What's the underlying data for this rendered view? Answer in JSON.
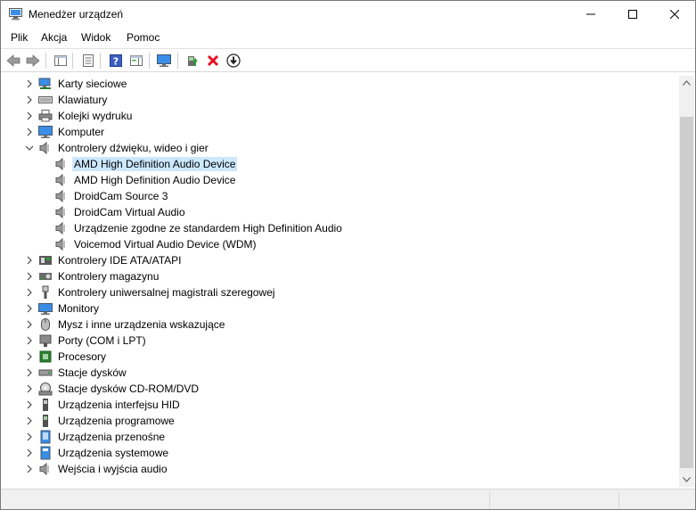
{
  "window": {
    "title": "Menedżer urządzeń"
  },
  "menu": [
    "Plik",
    "Akcja",
    "Widok",
    "Pomoc"
  ],
  "tree": [
    {
      "label": "Karty sieciowe",
      "icon": "network-adapter-icon",
      "expanded": false
    },
    {
      "label": "Klawiatury",
      "icon": "keyboard-icon",
      "expanded": false
    },
    {
      "label": "Kolejki wydruku",
      "icon": "printer-icon",
      "expanded": false
    },
    {
      "label": "Komputer",
      "icon": "computer-icon",
      "expanded": false
    },
    {
      "label": "Kontrolery dźwięku, wideo i gier",
      "icon": "speaker-icon",
      "expanded": true,
      "children": [
        {
          "label": "AMD High Definition Audio Device",
          "selected": true
        },
        {
          "label": "AMD High Definition Audio Device"
        },
        {
          "label": "DroidCam Source 3"
        },
        {
          "label": "DroidCam Virtual Audio"
        },
        {
          "label": "Urządzenie zgodne ze standardem High Definition Audio"
        },
        {
          "label": "Voicemod Virtual Audio Device (WDM)"
        }
      ]
    },
    {
      "label": "Kontrolery IDE ATA/ATAPI",
      "icon": "ide-controller-icon",
      "expanded": false
    },
    {
      "label": "Kontrolery magazynu",
      "icon": "storage-controller-icon",
      "expanded": false
    },
    {
      "label": "Kontrolery uniwersalnej magistrali szeregowej",
      "icon": "usb-icon",
      "expanded": false
    },
    {
      "label": "Monitory",
      "icon": "monitor-icon",
      "expanded": false
    },
    {
      "label": "Mysz i inne urządzenia wskazujące",
      "icon": "mouse-icon",
      "expanded": false
    },
    {
      "label": "Porty (COM i LPT)",
      "icon": "port-icon",
      "expanded": false
    },
    {
      "label": "Procesory",
      "icon": "processor-icon",
      "expanded": false
    },
    {
      "label": "Stacje dysków",
      "icon": "disk-drive-icon",
      "expanded": false
    },
    {
      "label": "Stacje dysków CD-ROM/DVD",
      "icon": "cdrom-icon",
      "expanded": false
    },
    {
      "label": "Urządzenia interfejsu HID",
      "icon": "hid-icon",
      "expanded": false
    },
    {
      "label": "Urządzenia programowe",
      "icon": "software-device-icon",
      "expanded": false
    },
    {
      "label": "Urządzenia przenośne",
      "icon": "portable-device-icon",
      "expanded": false
    },
    {
      "label": "Urządzenia systemowe",
      "icon": "system-device-icon",
      "expanded": false
    },
    {
      "label": "Wejścia i wyjścia audio",
      "icon": "audio-io-icon",
      "expanded": false
    }
  ],
  "colors": {
    "selection": "#cce8ff",
    "scrollbar_track": "#f0f0f0",
    "scrollbar_thumb": "#cdcdcd",
    "remove_red": "#e81123"
  }
}
